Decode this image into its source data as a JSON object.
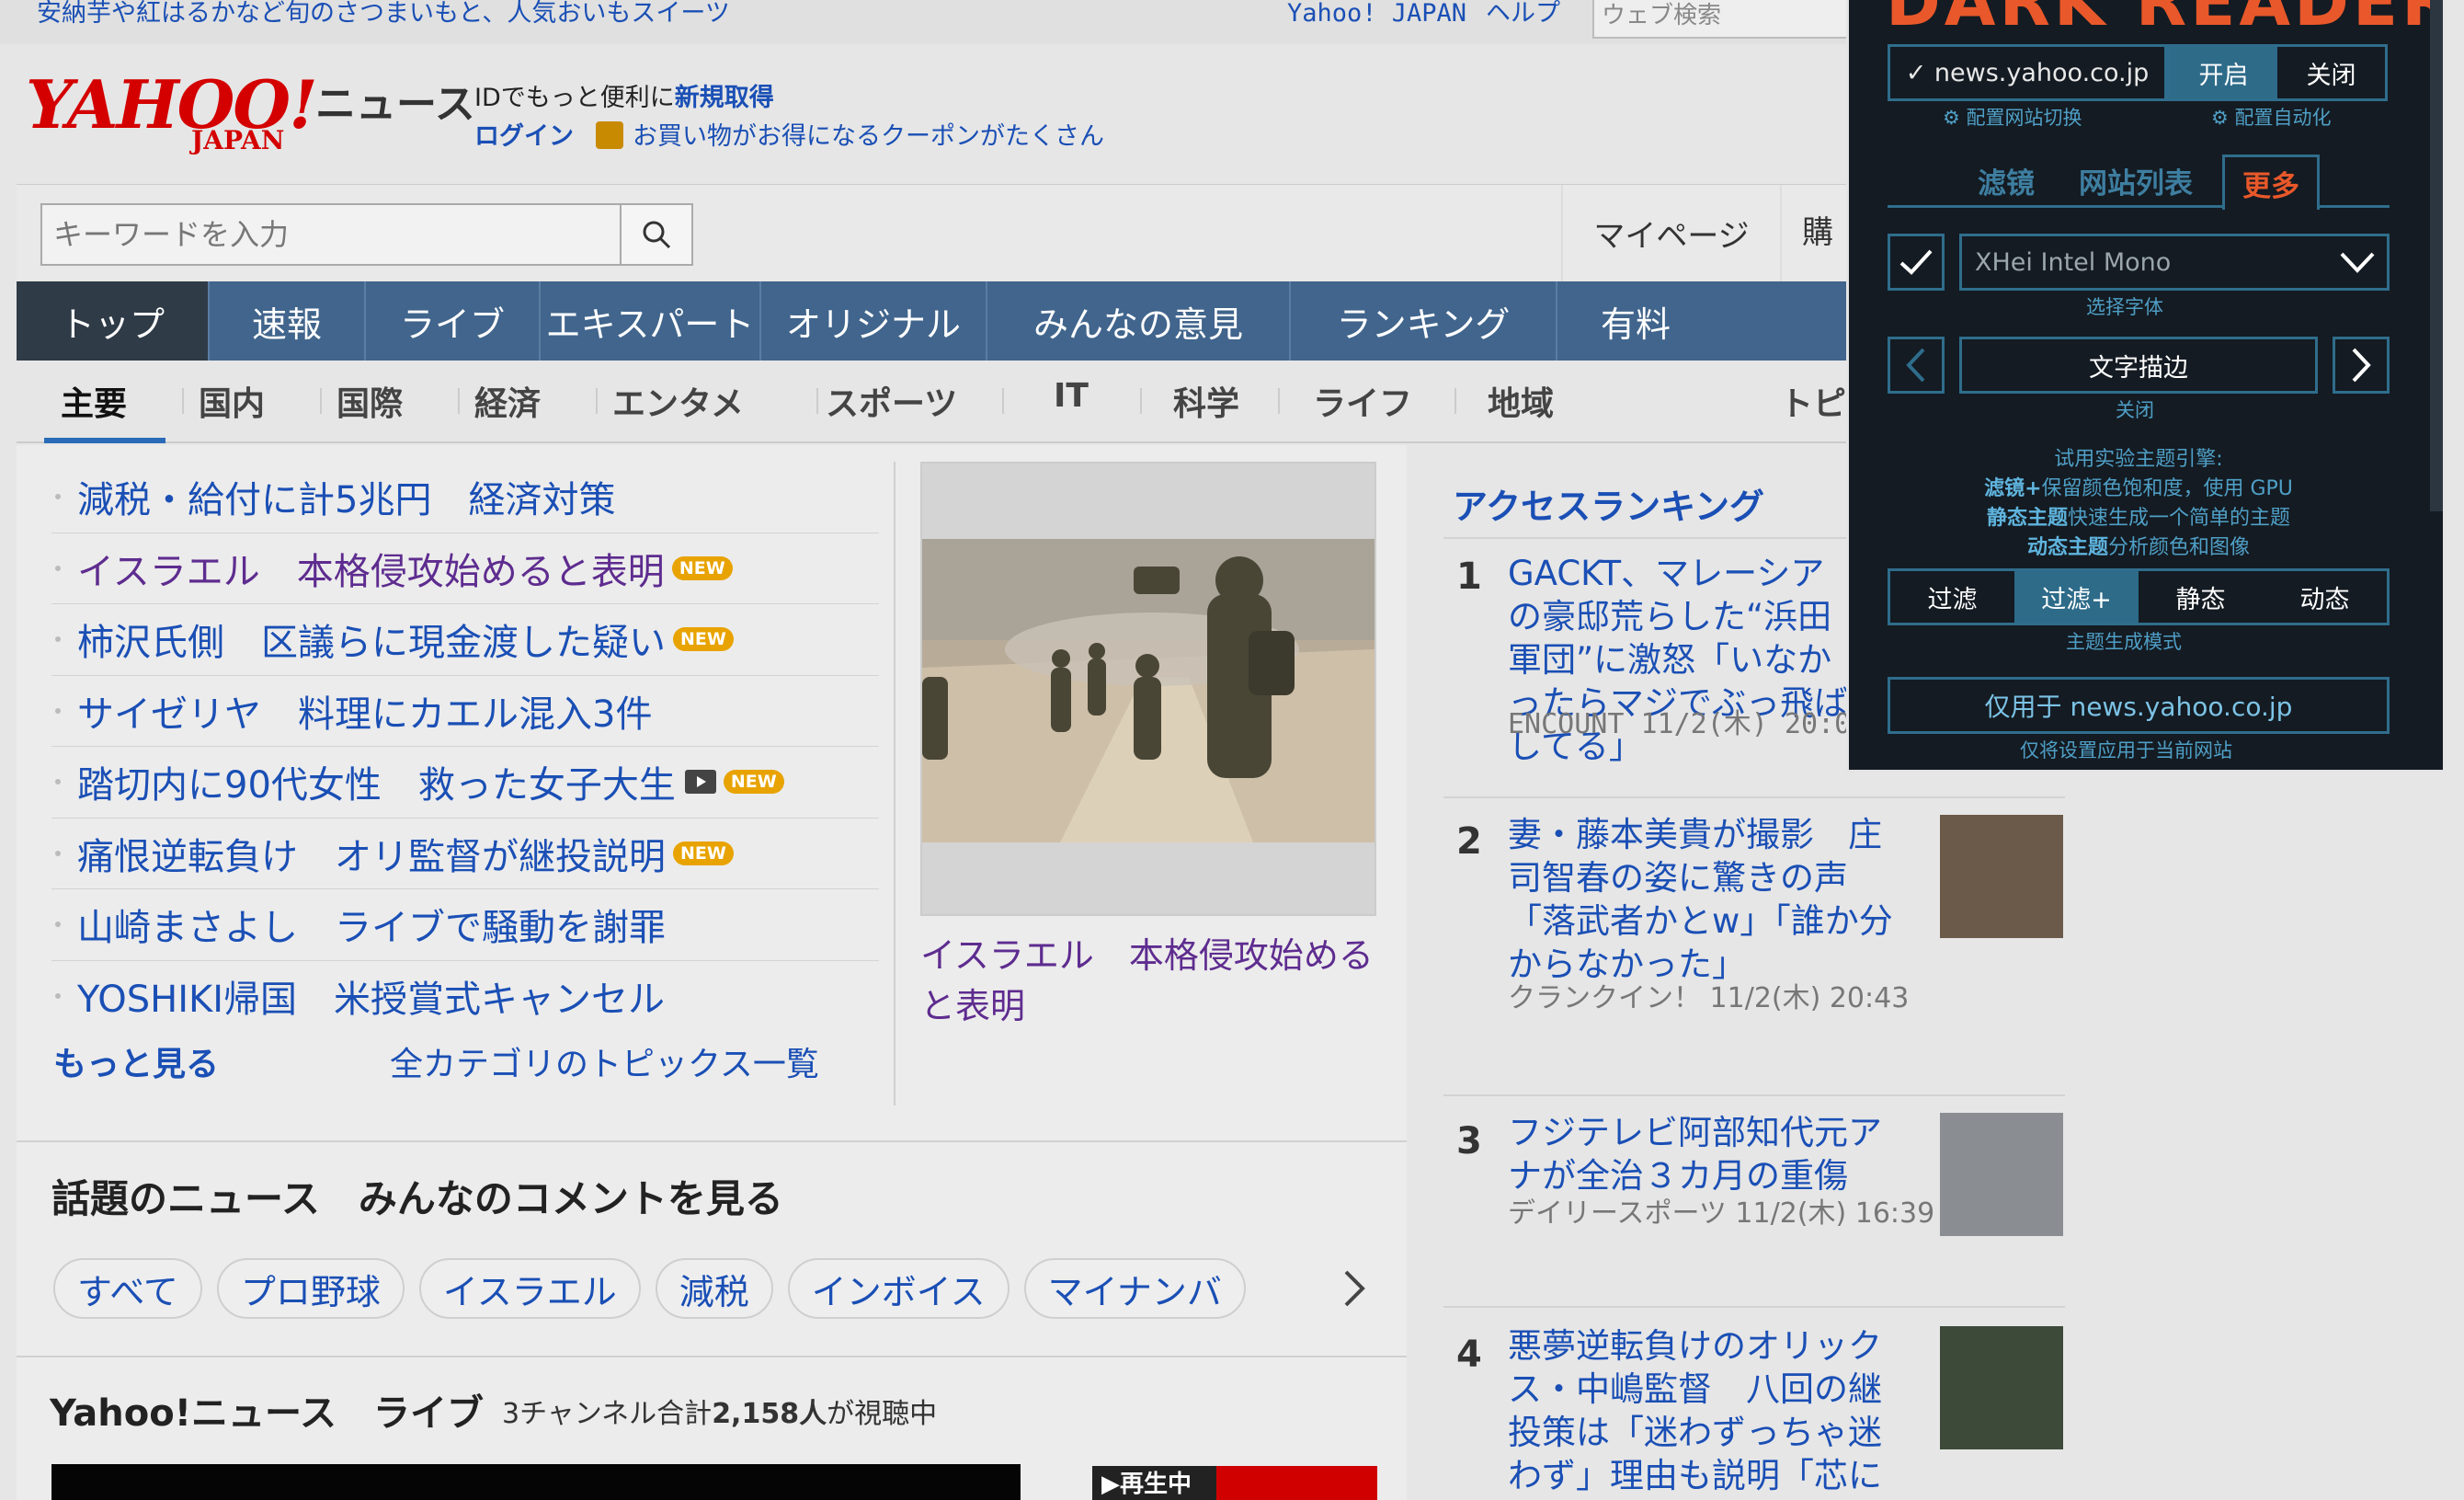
{
  "topbar": {
    "promo": "安納芋や紅はるかなど旬のさつまいもと、人気おいもスイーツ",
    "yahoo_japan": "Yahoo! JAPAN",
    "help": "ヘルプ",
    "web_search_placeholder": "ウェブ検索"
  },
  "logo": {
    "yahoo": "YAHOO!",
    "japan": "JAPAN",
    "news": "ニュース"
  },
  "account": {
    "id_text": "IDでもっと便利に",
    "register": "新規取得",
    "login": "ログイン",
    "coupon": "お買い物がお得になるクーポンがたくさん"
  },
  "search": {
    "placeholder": "キーワードを入力",
    "mypage": "マイページ",
    "shopping": "購入"
  },
  "nav": [
    "トップ",
    "速報",
    "ライブ",
    "エキスパート",
    "オリジナル",
    "みんなの意見",
    "ランキング",
    "有料"
  ],
  "subnav": [
    "主要",
    "国内",
    "国際",
    "経済",
    "エンタメ",
    "スポーツ",
    "IT",
    "科学",
    "ライフ",
    "地域",
    "トピ"
  ],
  "topics": [
    {
      "title": "減税・給付に計5兆円　経済対策",
      "new": ""
    },
    {
      "title": "イスラエル　本格侵攻始めると表明",
      "new": "NEW"
    },
    {
      "title": "柿沢氏側　区議らに現金渡した疑い",
      "new": "NEW"
    },
    {
      "title": "サイゼリヤ　料理にカエル混入3件",
      "new": ""
    },
    {
      "title": "踏切内に90代女性　救った女子大生",
      "new": "NEW"
    },
    {
      "title": "痛恨逆転負け　オリ監督が継投説明",
      "new": "NEW"
    },
    {
      "title": "山崎まさよし　ライブで騒動を謝罪",
      "new": ""
    },
    {
      "title": "YOSHIKI帰国　米授賞式キャンセル",
      "new": ""
    }
  ],
  "more": "もっと見る",
  "all_categories": "全カテゴリのトピックス一覧",
  "photo_caption": "イスラエル　本格侵攻始めると表明",
  "topic_news": {
    "title": "話題のニュース　みんなのコメントを見る",
    "tags": [
      "すべて",
      "プロ野球",
      "イスラエル",
      "減税",
      "インボイス",
      "マイナンバ"
    ]
  },
  "live": {
    "title": "Yahoo!ニュース　ライブ",
    "sub_prefix": "3チャンネル合計",
    "viewers": "2,158人",
    "sub_suffix": "が視聴中",
    "badge": "▶再生中"
  },
  "ranking": {
    "title": "アクセスランキング",
    "items": [
      {
        "num": "1",
        "text": "GACKT、マレーシアの豪邸荒らした“浜田軍団”に激怒「いなかったらマジでぶっ飛ばしてる」",
        "src": "ENCOUNT 11/2(木) 20:07"
      },
      {
        "num": "2",
        "text": "妻・藤本美貴が撮影　庄司智春の姿に驚きの声「落武者かとw」「誰か分からなかった」",
        "src": "クランクイン！ 11/2(木) 20:43"
      },
      {
        "num": "3",
        "text": "フジテレビ阿部知代元アナが全治３カ月の重傷",
        "src": "デイリースポーツ 11/2(木) 16:39"
      },
      {
        "num": "4",
        "text": "悪夢逆転負けのオリックス・中嶋監督　八回の継投策は「迷わずっちゃ迷わず」理由も説明「芯に当た",
        "src": ""
      }
    ]
  },
  "darkreader": {
    "title": "DARK READER",
    "site": "✓ news.yahoo.co.jp",
    "on": "开启",
    "off": "关闭",
    "site_toggle": "⚙ 配置网站切换",
    "auto": "⚙ 配置自动化",
    "tabs": [
      "滤镜",
      "网站列表",
      "更多"
    ],
    "font": "XHei Intel Mono",
    "font_label": "选择字体",
    "stroke": "文字描边",
    "stroke_value": "关闭",
    "info1": "试用实验主题引擎:",
    "info2_b": "滤镜+",
    "info2": "保留颜色饱和度，使用 GPU",
    "info3_b": "静态主题",
    "info3": "快速生成一个简单的主题",
    "info4_b": "动态主题",
    "info4": "分析颜色和图像",
    "modes": [
      "过滤",
      "过滤+",
      "静态",
      "动态"
    ],
    "mode_label": "主题生成模式",
    "only_for": "仅用于 news.yahoo.co.jp",
    "only_label": "仅将设置应用于当前网站"
  }
}
